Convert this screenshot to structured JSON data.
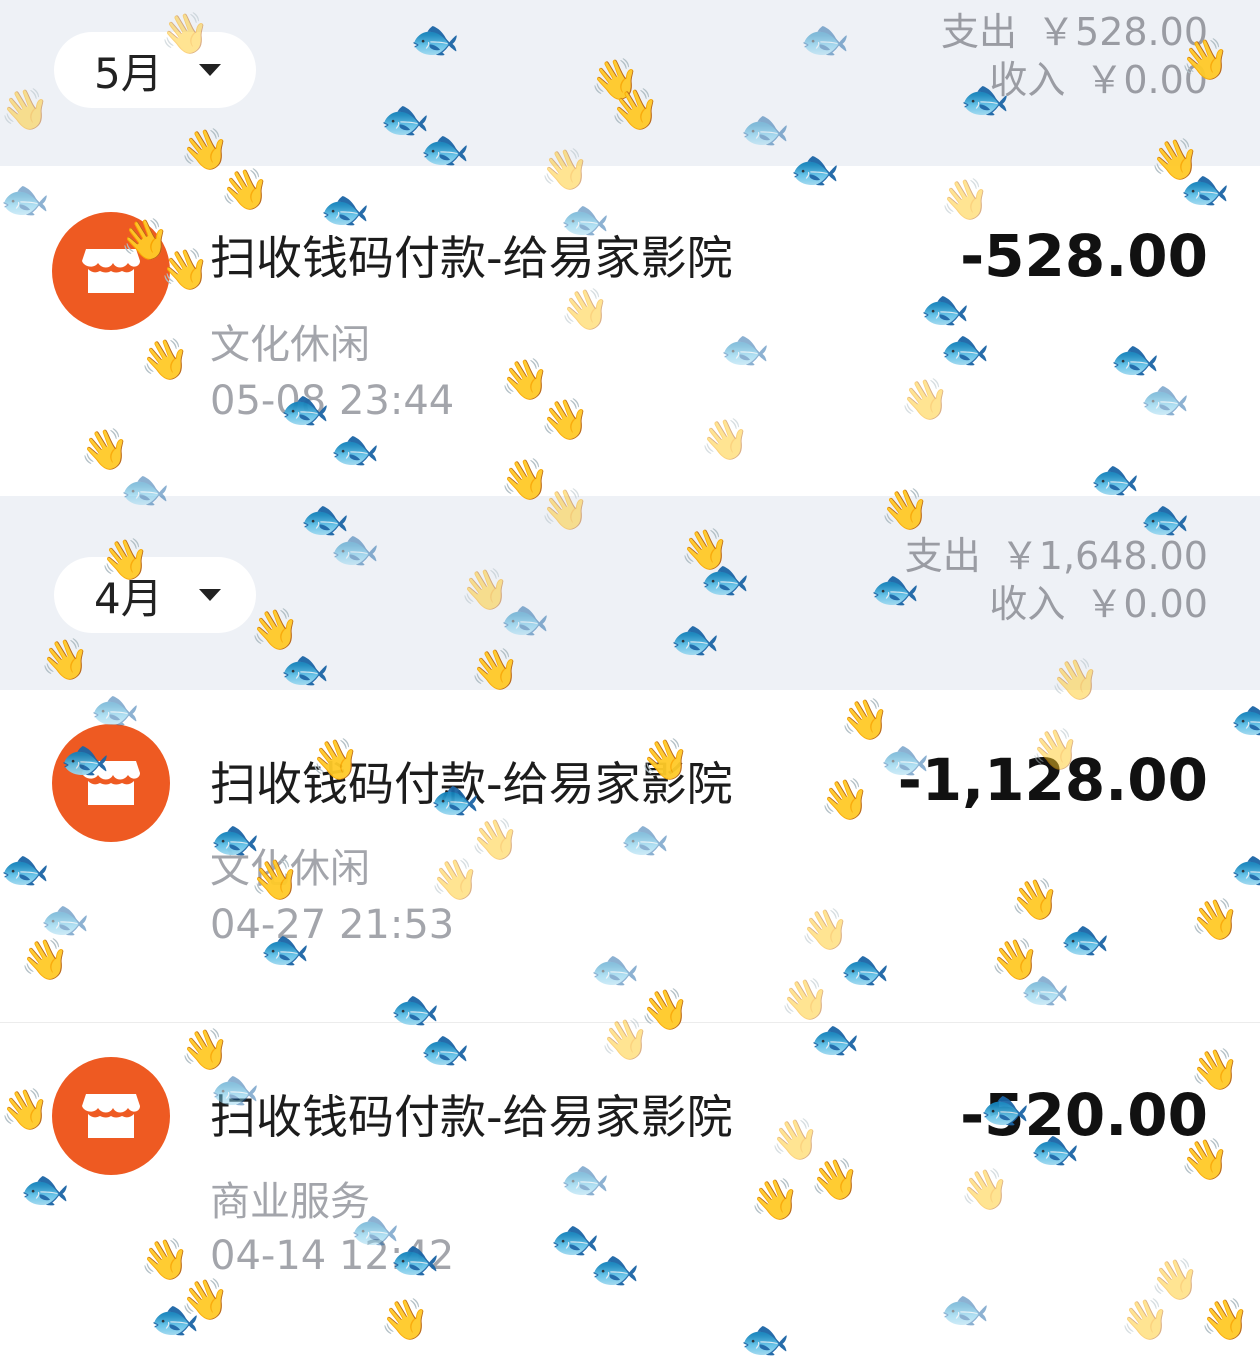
{
  "months": [
    {
      "label": "5月",
      "expense_label": "支出",
      "expense_value": "￥528.00",
      "income_label": "收入",
      "income_value": "￥0.00",
      "transactions": [
        {
          "title": "扫收钱码付款-给易家影院",
          "category": "文化休闲",
          "time": "05-08 23:44",
          "amount": "-528.00",
          "icon": "store-icon"
        }
      ]
    },
    {
      "label": "4月",
      "expense_label": "支出",
      "expense_value": "￥1,648.00",
      "income_label": "收入",
      "income_value": "￥0.00",
      "transactions": [
        {
          "title": "扫收钱码付款-给易家影院",
          "category": "文化休闲",
          "time": "04-27 21:53",
          "amount": "-1,128.00",
          "icon": "store-icon"
        },
        {
          "title": "扫收钱码付款-给易家影院",
          "category": "商业服务",
          "time": "04-14 12:42",
          "amount": "-520.00",
          "icon": "store-icon"
        }
      ]
    }
  ],
  "decorations": {
    "stickers": [
      "waving-hand-emoji",
      "fish-emoji"
    ],
    "colors": {
      "icon_orange": "#ee5a22",
      "header_bg": "#eef1f6"
    }
  }
}
